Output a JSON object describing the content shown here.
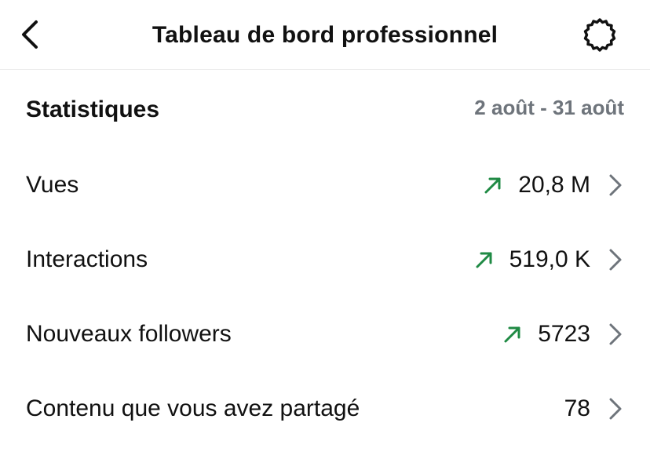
{
  "header": {
    "title": "Tableau de bord professionnel",
    "back_icon": "chevron-left-icon",
    "settings_icon": "gear-icon"
  },
  "stats": {
    "title": "Statistiques",
    "date_range": "2 août - 31 août",
    "rows": [
      {
        "label": "Vues",
        "value": "20,8 M",
        "trend": "up"
      },
      {
        "label": "Interactions",
        "value": "519,0 K",
        "trend": "up"
      },
      {
        "label": "Nouveaux followers",
        "value": "5723",
        "trend": "up"
      },
      {
        "label": "Contenu que vous avez partagé",
        "value": "78",
        "trend": "none"
      }
    ]
  },
  "colors": {
    "trend_up": "#1f8a44",
    "muted_text": "#6e747b",
    "chevron": "#6e747b",
    "divider": "#ececec"
  }
}
